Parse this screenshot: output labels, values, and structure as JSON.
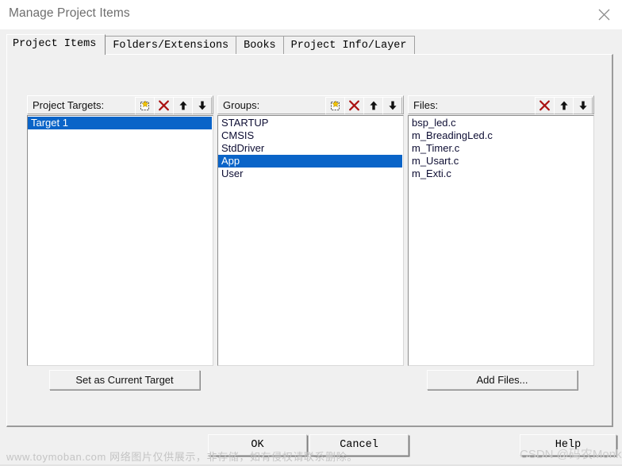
{
  "window": {
    "title": "Manage Project Items",
    "close_icon": "close-icon"
  },
  "tabs": [
    {
      "label": "Project Items",
      "active": true
    },
    {
      "label": "Folders/Extensions",
      "active": false
    },
    {
      "label": "Books",
      "active": false
    },
    {
      "label": "Project Info/Layer",
      "active": false
    }
  ],
  "columns": {
    "targets": {
      "label": "Project Targets:",
      "tools": [
        "new-item-icon",
        "delete-icon",
        "move-up-icon",
        "move-down-icon"
      ],
      "items": [
        {
          "label": "Target 1",
          "selected": true
        }
      ]
    },
    "groups": {
      "label": "Groups:",
      "tools": [
        "new-item-icon",
        "delete-icon",
        "move-up-icon",
        "move-down-icon"
      ],
      "items": [
        {
          "label": "STARTUP",
          "selected": false
        },
        {
          "label": "CMSIS",
          "selected": false
        },
        {
          "label": "StdDriver",
          "selected": false
        },
        {
          "label": "App",
          "selected": true
        },
        {
          "label": "User",
          "selected": false
        }
      ]
    },
    "files": {
      "label": "Files:",
      "tools": [
        "delete-icon",
        "move-up-icon",
        "move-down-icon"
      ],
      "items": [
        {
          "label": "bsp_led.c",
          "selected": false
        },
        {
          "label": "m_BreadingLed.c",
          "selected": false
        },
        {
          "label": "m_Timer.c",
          "selected": false
        },
        {
          "label": "m_Usart.c",
          "selected": false
        },
        {
          "label": "m_Exti.c",
          "selected": false
        }
      ]
    }
  },
  "actions": {
    "set_as_current_target": "Set as Current Target",
    "add_files": "Add Files..."
  },
  "footer": {
    "ok": "OK",
    "cancel": "Cancel",
    "help": "Help"
  },
  "watermarks": {
    "left": "www.toymoban.com 网络图片仅供展示，非存储，如有侵权请联系删除。",
    "right": "CSDN @码农Monkey"
  },
  "colors": {
    "selection_blue": "#0a64c8",
    "dialog_face": "#f0f0f0",
    "delete_red": "#aa1111",
    "title_gray": "#6e6e6e",
    "list_text": "#0d0d33"
  }
}
